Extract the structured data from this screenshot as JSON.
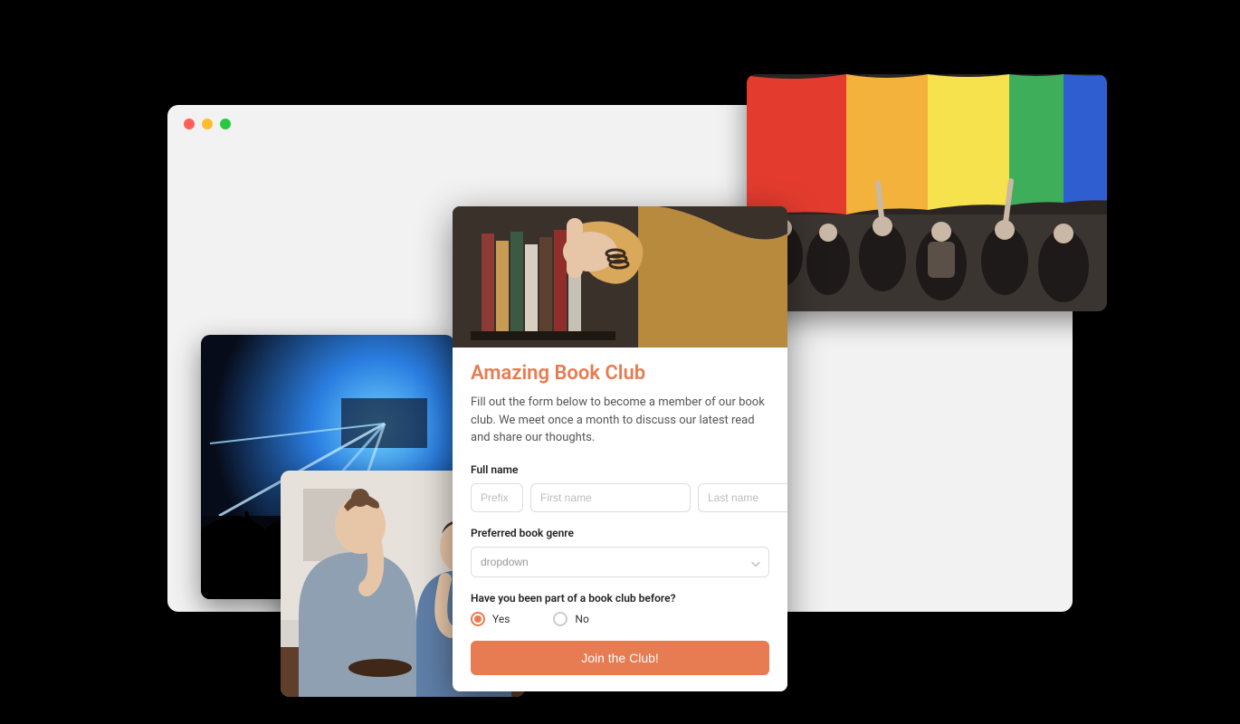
{
  "form": {
    "title": "Amazing Book Club",
    "description": "Fill out the form below to become a member of our book club. We meet once a month to discuss our latest read and share our thoughts.",
    "fullname_label": "Full name",
    "prefix_placeholder": "Prefix",
    "firstname_placeholder": "First name",
    "lastname_placeholder": "Last name",
    "genre_label": "Preferred book genre",
    "genre_dropdown_placeholder": "dropdown",
    "club_before_label": "Have you been part of a book club before?",
    "radio_yes": "Yes",
    "radio_no": "No",
    "submit_label": "Join the Club!"
  }
}
